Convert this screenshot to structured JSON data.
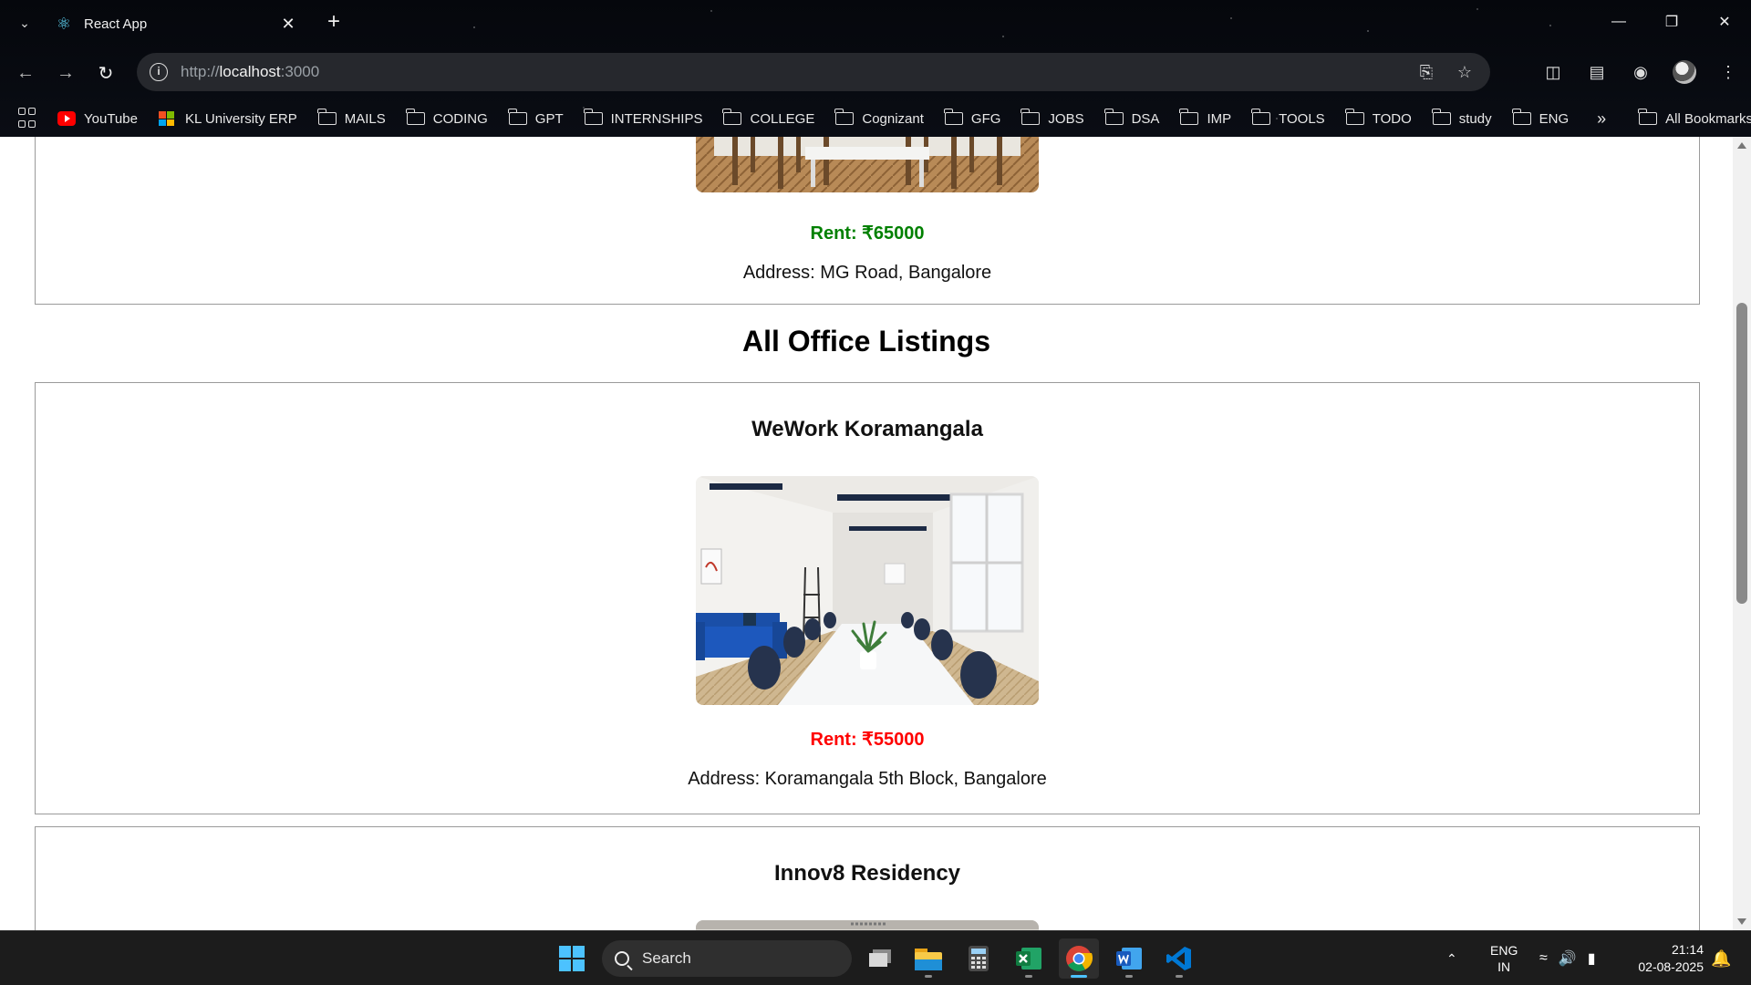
{
  "browser": {
    "tab_title": "React App",
    "url_scheme": "http://",
    "url_host": "localhost",
    "url_port": ":3000",
    "bookmarks": [
      {
        "label": "YouTube",
        "icon": "youtube-icon"
      },
      {
        "label": "KL University ERP",
        "icon": "microsoft-icon"
      },
      {
        "label": "MAILS",
        "icon": "folder-icon"
      },
      {
        "label": "CODING",
        "icon": "folder-icon"
      },
      {
        "label": "GPT",
        "icon": "folder-icon"
      },
      {
        "label": "INTERNSHIPS",
        "icon": "folder-icon"
      },
      {
        "label": "COLLEGE",
        "icon": "folder-icon"
      },
      {
        "label": "Cognizant",
        "icon": "folder-icon"
      },
      {
        "label": "GFG",
        "icon": "folder-icon"
      },
      {
        "label": "JOBS",
        "icon": "folder-icon"
      },
      {
        "label": "DSA",
        "icon": "folder-icon"
      },
      {
        "label": "IMP",
        "icon": "folder-icon"
      },
      {
        "label": "TOOLS",
        "icon": "folder-icon"
      },
      {
        "label": "TODO",
        "icon": "folder-icon"
      },
      {
        "label": "study",
        "icon": "folder-icon"
      },
      {
        "label": "ENG",
        "icon": "folder-icon"
      }
    ],
    "more_label": "»",
    "all_bookmarks_label": "All Bookmarks"
  },
  "page": {
    "top_card": {
      "rent": "Rent: ₹65000",
      "rent_color": "#008000",
      "address": "Address: MG Road, Bangalore"
    },
    "section_heading": "All Office Listings",
    "listings": [
      {
        "name": "WeWork Koramangala",
        "rent": "Rent: ₹55000",
        "rent_color": "#ff0000",
        "address": "Address: Koramangala 5th Block, Bangalore"
      },
      {
        "name": "Innov8 Residency"
      }
    ]
  },
  "taskbar": {
    "search_placeholder": "Search",
    "lang_top": "ENG",
    "lang_bottom": "IN",
    "time": "21:14",
    "date": "02-08-2025",
    "accent": "#4cc2ff"
  }
}
